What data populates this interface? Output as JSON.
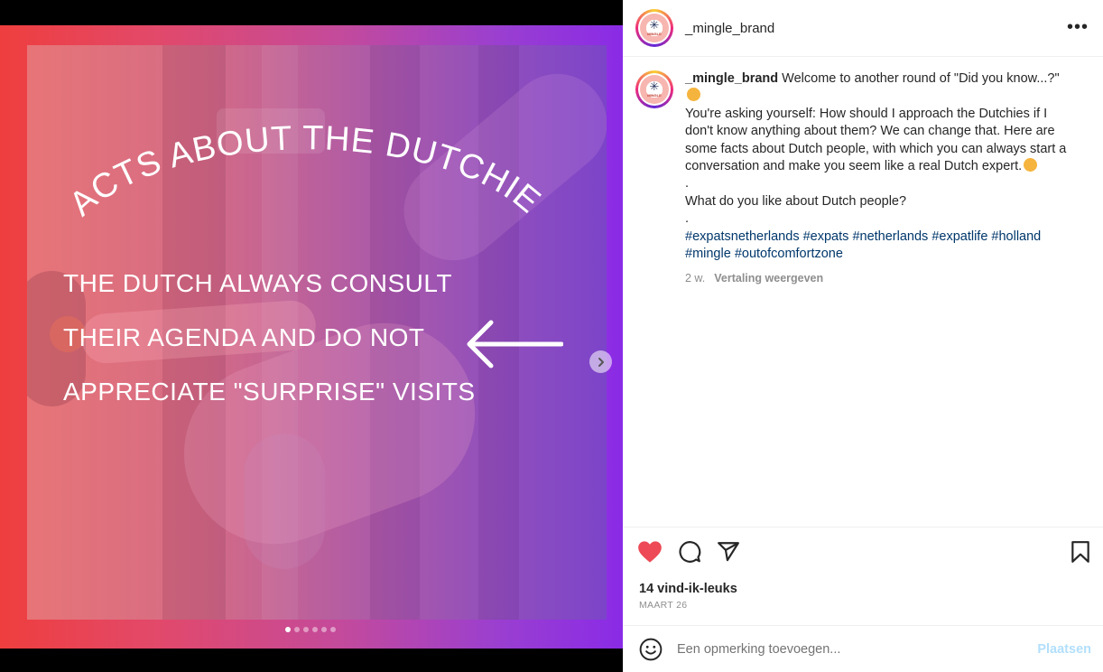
{
  "post": {
    "username": "_mingle_brand",
    "avatar_word": "MINGLE",
    "avatar_symbol": "✳",
    "image": {
      "curved_title": "FACTS ABOUT THE DUTCHIES",
      "fact_lines": [
        "THE DUTCH ALWAYS CONSULT",
        "THEIR AGENDA AND DO NOT",
        "APPRECIATE \"SURPRISE\" VISITS"
      ],
      "slide_count": 6,
      "active_slide": 1
    },
    "caption": {
      "username": "_mingle_brand",
      "line1": "Welcome to another round of \"Did you know...?\"",
      "paragraph": "You're asking yourself: How should I approach the Dutchies if I don't know anything about them? We can change that. Here are some facts about Dutch people, with which you can always start a conversation and make you seem like a real Dutch expert.",
      "dot1": ".",
      "question": "What do you like about Dutch people?",
      "dot2": ".",
      "hashtags": [
        "#expatsnetherlands",
        "#expats",
        "#netherlands",
        "#expatlife",
        "#holland",
        "#mingle",
        "#outofcomfortzone"
      ]
    },
    "meta": {
      "age": "2 w.",
      "translate_label": "Vertaling weergeven"
    },
    "likes": "14 vind-ik-leuks",
    "date": "MAART 26",
    "comment": {
      "placeholder": "Een opmerking toevoegen...",
      "post_label": "Plaatsen"
    },
    "colors": {
      "heart": "#ed4956",
      "link": "#00376b",
      "post_disabled": "#b2dffc"
    }
  }
}
